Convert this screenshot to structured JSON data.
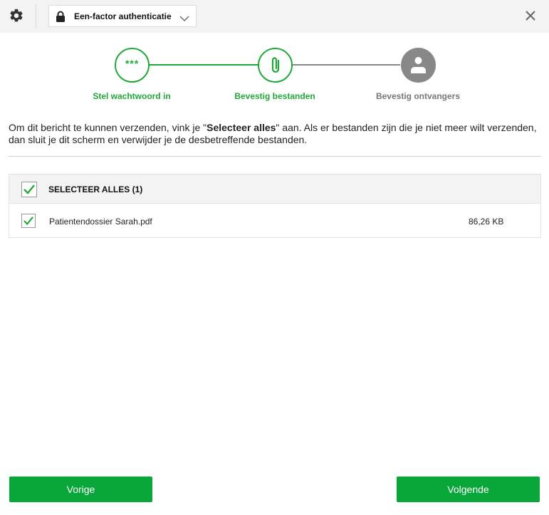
{
  "header": {
    "settings_icon": "gear-icon",
    "auth_select": {
      "icon": "lock-icon",
      "value": "Een-factor authenticatie"
    },
    "close_icon": "close-icon"
  },
  "stepper": {
    "steps": [
      {
        "label": "Stel wachtwoord in",
        "icon_text": "***",
        "state": "done"
      },
      {
        "label": "Bevestig bestanden",
        "icon": "paperclip-icon",
        "state": "active"
      },
      {
        "label": "Bevestig ontvangers",
        "icon": "user-icon",
        "state": "pending"
      }
    ],
    "colors": {
      "active": "#22a838",
      "pending": "#888888"
    }
  },
  "instructions": {
    "prefix": "Om dit bericht te kunnen verzenden, vink je \"",
    "bold": "Selecteer alles",
    "suffix": "\" aan. Als er bestanden zijn die je niet meer wilt verzenden, dan sluit je dit scherm en verwijder je de desbetreffende bestanden."
  },
  "files": {
    "select_all_label": "SELECTEER ALLES (1)",
    "select_all_checked": true,
    "rows": [
      {
        "name": "Patientendossier Sarah.pdf",
        "size": "86,26 KB",
        "checked": true
      }
    ]
  },
  "footer": {
    "prev_label": "Vorige",
    "next_label": "Volgende",
    "button_color": "#09a63a"
  }
}
